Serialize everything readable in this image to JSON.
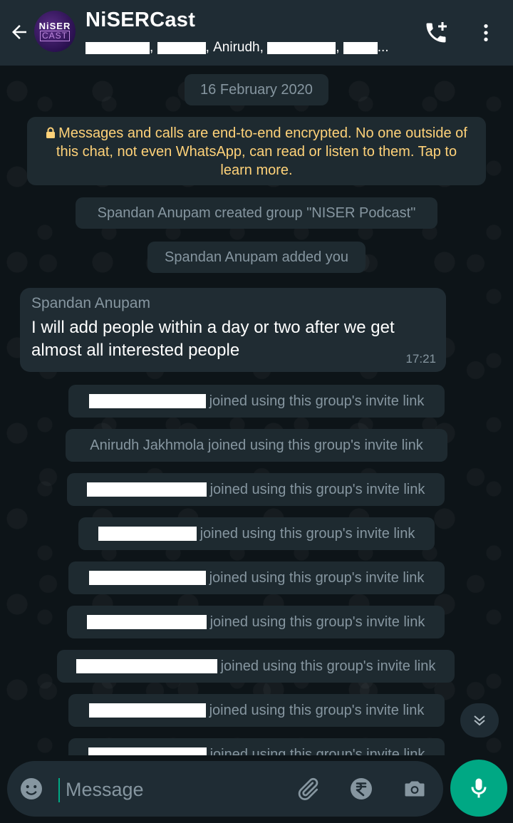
{
  "header": {
    "title": "NiSERCast",
    "avatar_line1": "NiSER",
    "avatar_line2": "CAST",
    "participant_visible": "Anirudh,",
    "ellipsis": "..."
  },
  "chat": {
    "date_chip": "16 February 2020",
    "encryption_notice": "Messages and calls are end-to-end encrypted. No one outside of this chat, not even WhatsApp, can read or listen to them. Tap to learn more.",
    "system_created": "Spandan Anupam created group \"NISER Podcast\"",
    "system_added": "Spandan Anupam added you",
    "message": {
      "sender": "Spandan Anupam",
      "text": "I will add people within a day or two after we get almost all interested people",
      "time": "17:21"
    },
    "joined_suffix": "joined using this group's invite link",
    "joined_named": "Anirudh Jakhmola joined using this group's invite link"
  },
  "footer": {
    "message_placeholder": "Message"
  },
  "icons": [
    "back-arrow-icon",
    "add-call-icon",
    "more-vert-icon",
    "lock-icon",
    "scroll-down-icon",
    "emoji-icon",
    "attach-icon",
    "rupee-icon",
    "camera-icon",
    "mic-icon"
  ],
  "colors": {
    "header_bg": "#1f2c34",
    "chat_bg": "#0d1418",
    "bubble_bg": "#202c33",
    "system_text": "#8696a0",
    "encryption_text": "#ffd279",
    "accent": "#00a884"
  }
}
